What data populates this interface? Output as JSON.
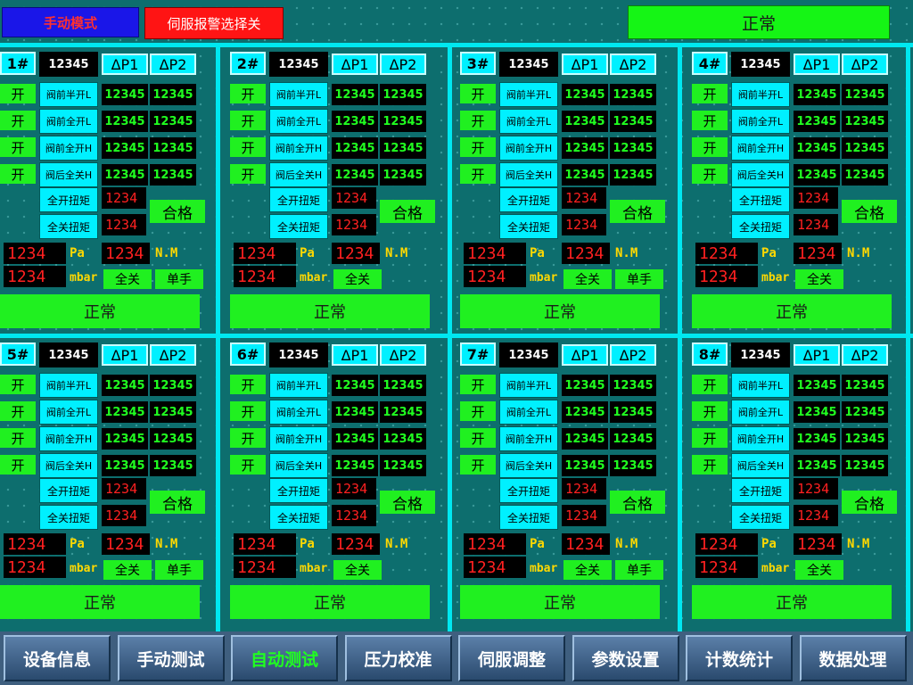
{
  "header": {
    "mode_label": "手动模式",
    "servo_alarm_label": "伺服报警选择关",
    "system_status": "正常"
  },
  "labels": {
    "delta_p1": "ΔP1",
    "delta_p2": "ΔP2",
    "open": "开",
    "valves": [
      "阀前半开L",
      "阀前全开L",
      "阀前全开H",
      "阀后全关H"
    ],
    "torque_open": "全开扭矩",
    "torque_close": "全关扭矩",
    "pass": "合格",
    "pa": "Pa",
    "mbar": "mbar",
    "nm": "N.M",
    "full_close": "全关",
    "single_hand": "单手",
    "status": "正常"
  },
  "units": [
    {
      "id": "1#",
      "sensor": "12345",
      "dp": [
        [
          "12345",
          "12345"
        ],
        [
          "12345",
          "12345"
        ],
        [
          "12345",
          "12345"
        ],
        [
          "12345",
          "12345"
        ]
      ],
      "torque_open": "1234",
      "torque_close": "1234",
      "pressure_pa": "1234",
      "pressure_mbar": "1234",
      "torque_nm": "1234",
      "show_single": true
    },
    {
      "id": "2#",
      "sensor": "12345",
      "dp": [
        [
          "12345",
          "12345"
        ],
        [
          "12345",
          "12345"
        ],
        [
          "12345",
          "12345"
        ],
        [
          "12345",
          "12345"
        ]
      ],
      "torque_open": "1234",
      "torque_close": "1234",
      "pressure_pa": "1234",
      "pressure_mbar": "1234",
      "torque_nm": "1234",
      "show_single": false
    },
    {
      "id": "3#",
      "sensor": "12345",
      "dp": [
        [
          "12345",
          "12345"
        ],
        [
          "12345",
          "12345"
        ],
        [
          "12345",
          "12345"
        ],
        [
          "12345",
          "12345"
        ]
      ],
      "torque_open": "1234",
      "torque_close": "1234",
      "pressure_pa": "1234",
      "pressure_mbar": "1234",
      "torque_nm": "1234",
      "show_single": true
    },
    {
      "id": "4#",
      "sensor": "12345",
      "dp": [
        [
          "12345",
          "12345"
        ],
        [
          "12345",
          "12345"
        ],
        [
          "12345",
          "12345"
        ],
        [
          "12345",
          "12345"
        ]
      ],
      "torque_open": "1234",
      "torque_close": "1234",
      "pressure_pa": "1234",
      "pressure_mbar": "1234",
      "torque_nm": "1234",
      "show_single": false
    },
    {
      "id": "5#",
      "sensor": "12345",
      "dp": [
        [
          "12345",
          "12345"
        ],
        [
          "12345",
          "12345"
        ],
        [
          "12345",
          "12345"
        ],
        [
          "12345",
          "12345"
        ]
      ],
      "torque_open": "1234",
      "torque_close": "1234",
      "pressure_pa": "1234",
      "pressure_mbar": "1234",
      "torque_nm": "1234",
      "show_single": true
    },
    {
      "id": "6#",
      "sensor": "12345",
      "dp": [
        [
          "12345",
          "12345"
        ],
        [
          "12345",
          "12345"
        ],
        [
          "12345",
          "12345"
        ],
        [
          "12345",
          "12345"
        ]
      ],
      "torque_open": "1234",
      "torque_close": "1234",
      "pressure_pa": "1234",
      "pressure_mbar": "1234",
      "torque_nm": "1234",
      "show_single": false
    },
    {
      "id": "7#",
      "sensor": "12345",
      "dp": [
        [
          "12345",
          "12345"
        ],
        [
          "12345",
          "12345"
        ],
        [
          "12345",
          "12345"
        ],
        [
          "12345",
          "12345"
        ]
      ],
      "torque_open": "1234",
      "torque_close": "1234",
      "pressure_pa": "1234",
      "pressure_mbar": "1234",
      "torque_nm": "1234",
      "show_single": true
    },
    {
      "id": "8#",
      "sensor": "12345",
      "dp": [
        [
          "12345",
          "12345"
        ],
        [
          "12345",
          "12345"
        ],
        [
          "12345",
          "12345"
        ],
        [
          "12345",
          "12345"
        ]
      ],
      "torque_open": "1234",
      "torque_close": "1234",
      "pressure_pa": "1234",
      "pressure_mbar": "1234",
      "torque_nm": "1234",
      "show_single": false
    }
  ],
  "nav": [
    "设备信息",
    "手动测试",
    "自动测试",
    "压力校准",
    "伺服调整",
    "参数设置",
    "计数统计",
    "数据处理"
  ],
  "nav_active": "自动测试",
  "colors": {
    "background": "#0d6e6e",
    "accent_cyan": "#00f0ff",
    "ok_green": "#20f020",
    "alarm_red": "#ff1414",
    "value_red": "#ff2020",
    "value_green": "#20ff20",
    "unit_yellow": "#ffd800"
  }
}
